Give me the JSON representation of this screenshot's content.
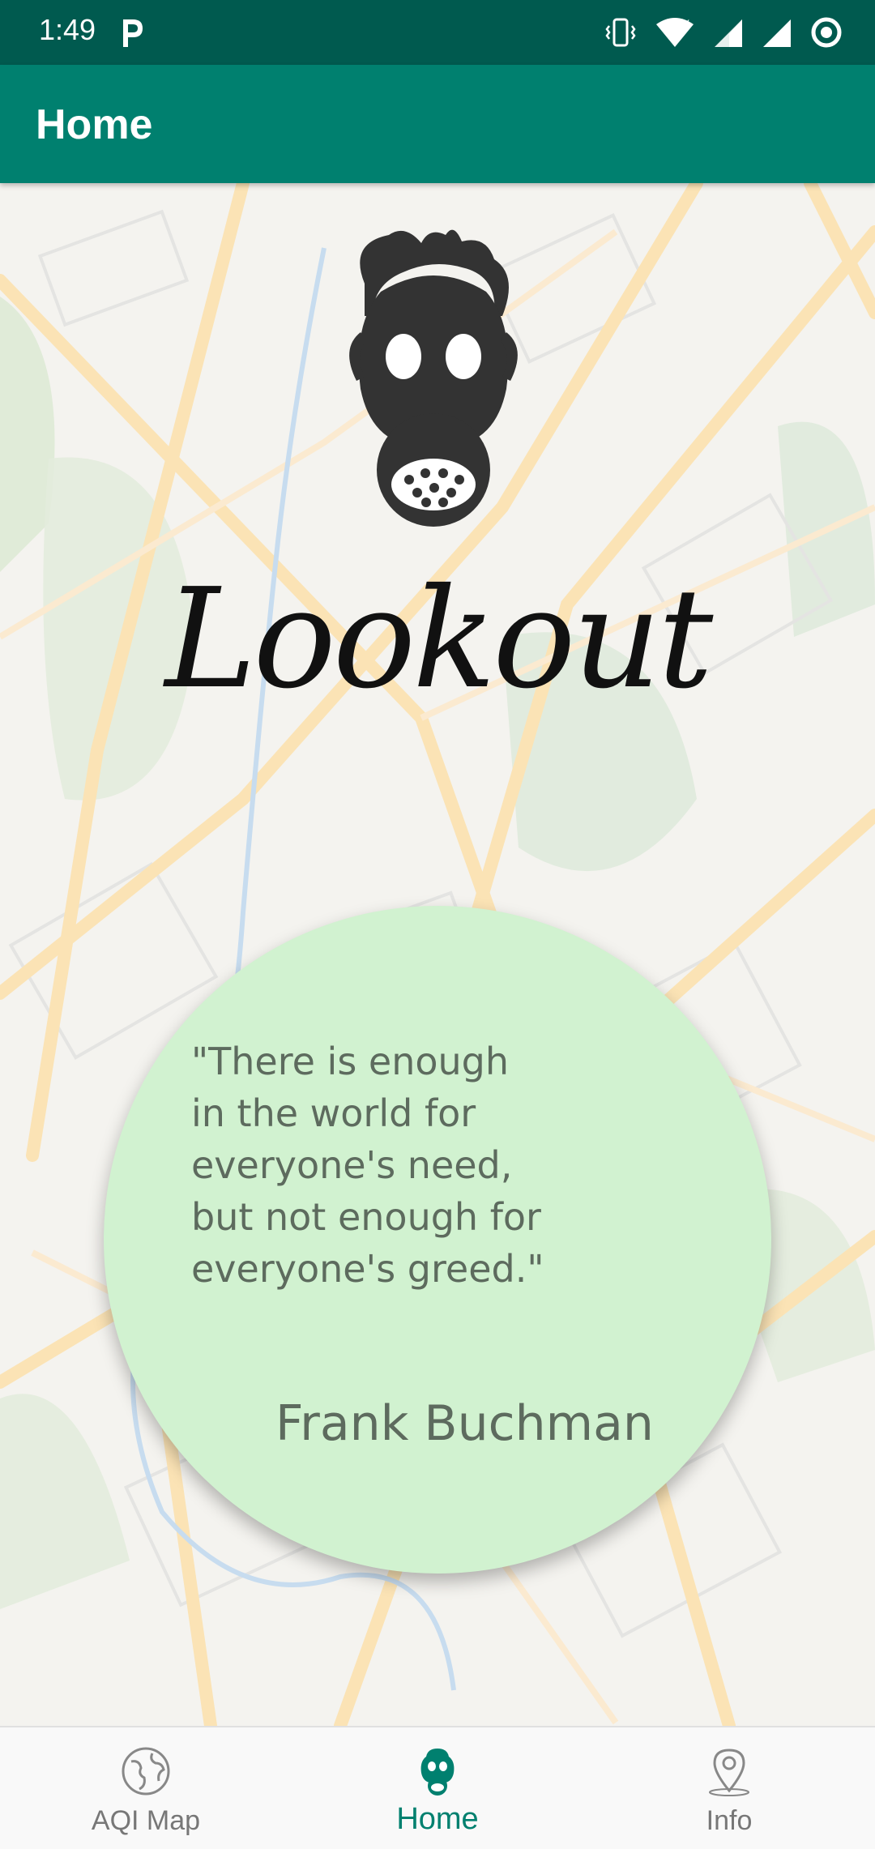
{
  "status_bar": {
    "time": "1:49",
    "app_badge_icon": "parking-p-icon",
    "icons": [
      "vibrate-icon",
      "wifi-icon",
      "signal-icon",
      "signal-icon",
      "target-icon"
    ]
  },
  "app_bar": {
    "title": "Home"
  },
  "brand": {
    "name": "Lookout",
    "logo_icon": "gas-mask-icon"
  },
  "quote": {
    "text": "\"There is enough\nin the world for\neveryone's need,\nbut not enough for\neveryone's greed.\"",
    "author": "Frank Buchman"
  },
  "bottom_nav": {
    "items": [
      {
        "label": "AQI Map",
        "icon": "globe-icon",
        "active": false
      },
      {
        "label": "Home",
        "icon": "gas-mask-icon",
        "active": true
      },
      {
        "label": "Info",
        "icon": "location-pin-icon",
        "active": false
      }
    ]
  },
  "colors": {
    "status_bar": "#005a4f",
    "app_bar": "#00806f",
    "quote_circle": "#d1f2d0",
    "active_tab": "#00806f"
  }
}
